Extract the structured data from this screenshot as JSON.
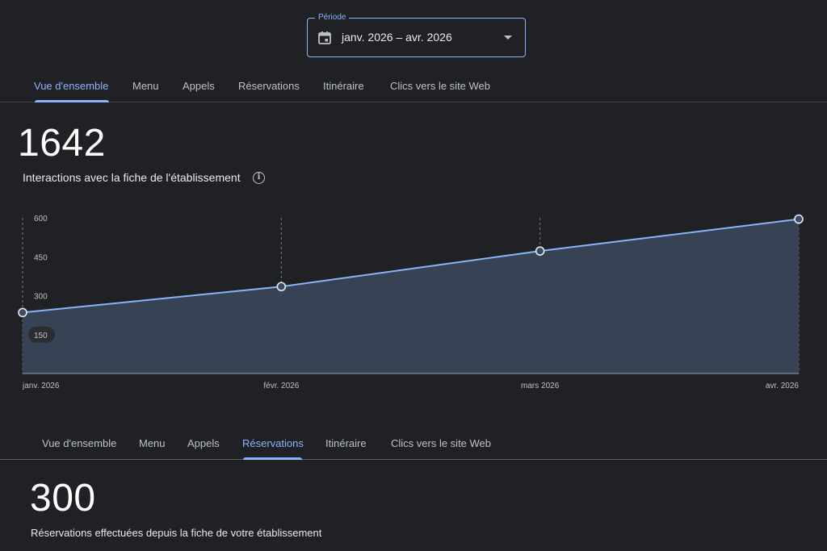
{
  "period": {
    "legend": "Période",
    "value": "janv. 2026 – avr. 2026"
  },
  "tabs_top": [
    {
      "label": "Vue d'ensemble",
      "active": true
    },
    {
      "label": "Menu",
      "active": false
    },
    {
      "label": "Appels",
      "active": false
    },
    {
      "label": "Réservations",
      "active": false
    },
    {
      "label": "Itinéraire",
      "active": false
    },
    {
      "label": "Clics vers le site Web",
      "active": false
    }
  ],
  "overview": {
    "total": "1642",
    "subtitle": "Interactions avec la fiche de l'établissement"
  },
  "chart_data": {
    "type": "area",
    "x": [
      "janv. 2026",
      "févr. 2026",
      "mars 2026",
      "avr. 2026"
    ],
    "values": [
      235,
      335,
      472,
      595
    ],
    "y_ticks": [
      150,
      300,
      450,
      600
    ],
    "ylim": [
      0,
      600
    ],
    "grid": "vertical dashed",
    "colors": {
      "line": "#8ab4f8",
      "fill": "#394457"
    }
  },
  "tabs_bottom": [
    {
      "label": "Vue d'ensemble",
      "active": false
    },
    {
      "label": "Menu",
      "active": false
    },
    {
      "label": "Appels",
      "active": false
    },
    {
      "label": "Réservations",
      "active": true
    },
    {
      "label": "Itinéraire",
      "active": false
    },
    {
      "label": "Clics vers le site Web",
      "active": false
    }
  ],
  "reservations": {
    "total": "300",
    "subtitle": "Réservations effectuées depuis la fiche de votre établissement"
  }
}
